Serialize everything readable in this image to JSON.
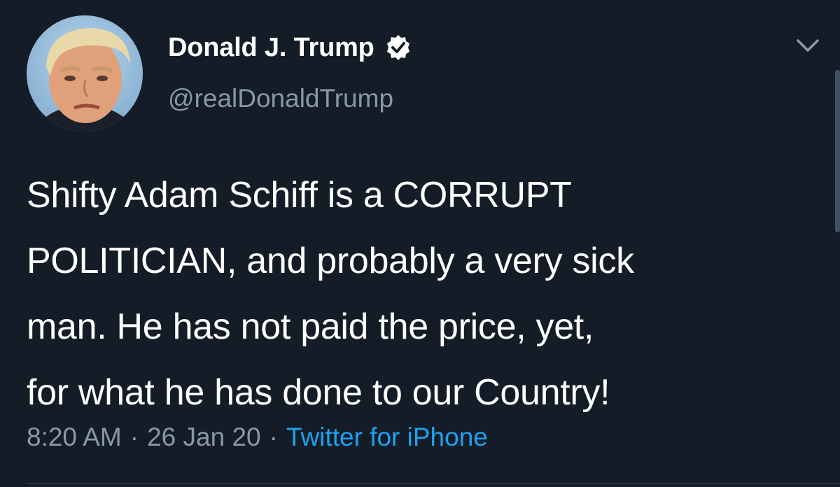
{
  "author": {
    "display_name": "Donald J. Trump",
    "handle": "@realDonaldTrump",
    "avatar_icon": "profile-photo",
    "verified_icon": "verified-badge-icon"
  },
  "tweet": {
    "lines": [
      "Shifty Adam Schiff is a CORRUPT",
      "POLITICIAN, and probably a very sick",
      "man. He has not paid the price, yet,",
      "for what he has done to our Country!"
    ]
  },
  "meta": {
    "time": "8:20 AM",
    "separator": "·",
    "date": "26 Jan 20",
    "source": "Twitter for iPhone"
  },
  "colors": {
    "background": "#141d27",
    "secondary_text": "#8899a6",
    "accent": "#1da1f2"
  },
  "icons": {
    "menu": "chevron-down-icon"
  }
}
